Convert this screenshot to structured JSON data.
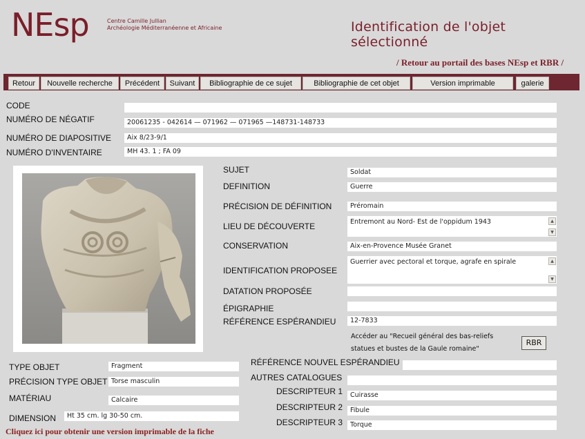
{
  "header": {
    "logo": "NEsp",
    "centre_line1": "Centre Camille Jullian",
    "centre_line2": "Archéologie Méditerranéenne et Africaine",
    "title": "Identification de l'objet sélectionné",
    "portal_link": "/ Retour au portail des bases NEsp et RBR /"
  },
  "nav": [
    "Retour",
    "Nouvelle recherche",
    "Précédent",
    "Suivant",
    "Bibliographie de ce sujet",
    "Bibliographie de cet objet",
    "Version imprimable",
    "galerie"
  ],
  "top_fields": [
    {
      "label": "CODE",
      "value": ""
    },
    {
      "label": "NUMÉRO DE NÉGATIF",
      "value": "20061235 - 042614 — 071962  — 071965 —148731-148733"
    },
    {
      "label": "NUMÉRO DE DIAPOSITIVE",
      "value": "Aix 8/23-9/1"
    },
    {
      "label": "NUMÉRO D'INVENTAIRE",
      "value": "MH 43. 1 ; FA 09"
    }
  ],
  "right_fields": {
    "sujet": {
      "label": "SUJET",
      "value": "Soldat"
    },
    "definition": {
      "label": "DEFINITION",
      "value": "Guerre"
    },
    "precision_def": {
      "label": "PRÉCISION DE DÉFINITION",
      "value": "Préromain"
    },
    "lieu": {
      "label": "LIEU DE DÉCOUVERTE",
      "value": "Entremont au Nord- Est de l'oppidum 1943"
    },
    "conservation": {
      "label": "CONSERVATION",
      "value": "Aix-en-Provence Musée Granet"
    },
    "identification": {
      "label": "IDENTIFICATION PROPOSEE",
      "value": "Guerrier avec pectoral et torque, agrafe en spirale"
    },
    "datation": {
      "label": "DATATION PROPOSÉE",
      "value": ""
    },
    "epigraphie": {
      "label": "ÉPIGRAPHIE",
      "value": ""
    },
    "ref_esp": {
      "label": "RÉFÉRENCE ESPÉRANDIEU",
      "value": "12-7833"
    }
  },
  "acceder_line1": "Accéder au \"Recueil général des bas-reliefs",
  "acceder_line2": "statues et bustes de la Gaule romaine\"",
  "rbr_button": "RBR",
  "bottom_left": {
    "type_objet": {
      "label": "TYPE OBJET",
      "value": "Fragment"
    },
    "precision_type": {
      "label": "PRÉCISION TYPE OBJET",
      "value": "Torse masculin"
    },
    "materiau": {
      "label": "MATÉRIAU",
      "value": "Calcaire"
    },
    "dimension": {
      "label": "DIMENSION",
      "value": "Ht 35 cm. lg 30-50 cm."
    }
  },
  "bottom_right": {
    "ref_nouvel": {
      "label": "RÉFÉRENCE NOUVEL ESPÉRANDIEU",
      "value": ""
    },
    "autres": {
      "label": "AUTRES CATALOGUES",
      "value": ""
    },
    "desc1": {
      "label": "DESCRIPTEUR 1",
      "value": "Cuirasse"
    },
    "desc2": {
      "label": "DESCRIPTEUR 2",
      "value": "Fibule"
    },
    "desc3": {
      "label": "DESCRIPTEUR 3",
      "value": "Torque"
    }
  },
  "print_link": "Cliquez ici pour obtenir une version imprimable de la fiche",
  "colors": {
    "brand": "#7a1f2a",
    "navbar": "#6e2631",
    "background": "#d9d9d9"
  }
}
